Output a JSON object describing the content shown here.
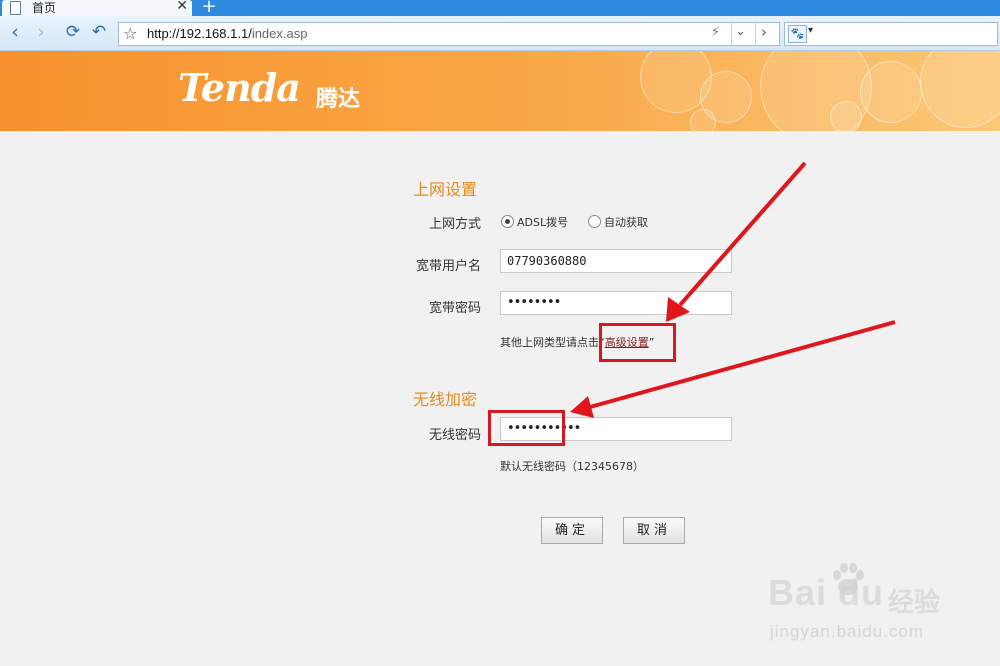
{
  "browser": {
    "tab_title": "首页",
    "tab_close": "✕",
    "new_tab": "+",
    "url_host": "http://192.168.1.1/",
    "url_path": "index.asp",
    "search_engine_icon": "paw-icon"
  },
  "header": {
    "logo": "Tenda",
    "logo_cn": "腾达",
    "colors": {
      "start": "#f7922c",
      "end": "#fbc878"
    }
  },
  "internet": {
    "title": "上网设置",
    "method_label": "上网方式",
    "methods": [
      {
        "label": "ADSL拨号",
        "selected": true
      },
      {
        "label": "自动获取",
        "selected": false
      }
    ],
    "username_label": "宽带用户名",
    "username_value": "07790360880",
    "password_label": "宽带密码",
    "password_value": "••••••••",
    "other_hint": "其他上网类型请点击“",
    "advanced_link": "高级设置",
    "other_hint_end": "”"
  },
  "wireless": {
    "title": "无线加密",
    "password_label": "无线密码",
    "password_value": "•••••••••••",
    "default_hint": "默认无线密码（12345678）"
  },
  "buttons": {
    "ok": "确定",
    "cancel": "取消"
  },
  "watermark": {
    "brand": "Bai du",
    "cn": "经验",
    "url": "jingyan.baidu.com"
  },
  "annotation_color": "#d4191f"
}
